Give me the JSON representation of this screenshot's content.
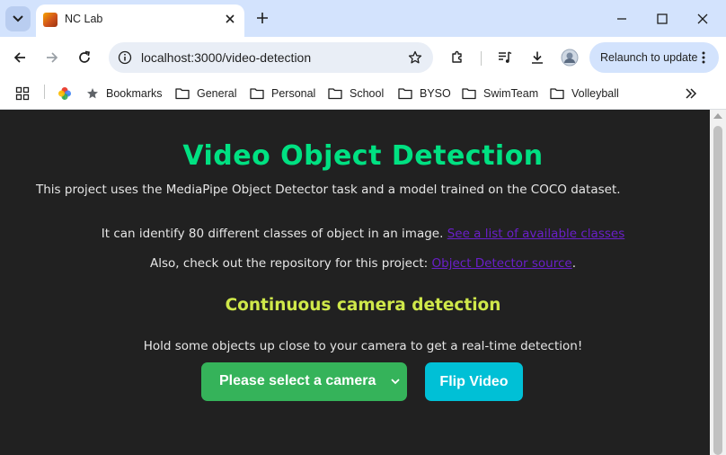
{
  "browser": {
    "tab": {
      "title": "NC Lab",
      "favicon": "nc-lab-favicon"
    },
    "address": {
      "url": "localhost:3000/video-detection"
    },
    "relaunch_label": "Relaunch to update",
    "bookmarks": [
      {
        "label": "Bookmarks",
        "icon": "star-icon"
      },
      {
        "label": "General",
        "icon": "folder-icon"
      },
      {
        "label": "Personal",
        "icon": "folder-icon"
      },
      {
        "label": "School",
        "icon": "folder-icon"
      },
      {
        "label": "BYSO",
        "icon": "folder-icon"
      },
      {
        "label": "SwimTeam",
        "icon": "folder-icon"
      },
      {
        "label": "Volleyball",
        "icon": "folder-icon"
      }
    ]
  },
  "page": {
    "title": "Video Object Detection",
    "intro": "This project uses the MediaPipe Object Detector task and a model trained on the COCO dataset.",
    "classes_text": "It can identify 80 different classes of object in an image. ",
    "classes_link": "See a list of available classes",
    "repo_text": "Also, check out the repository for this project: ",
    "repo_link": "Object Detector source",
    "repo_suffix": ".",
    "section_title": "Continuous camera detection",
    "instruction": "Hold some objects up close to your camera to get a real-time detection!",
    "camera_select": "Please select a camera",
    "flip_button": "Flip Video"
  },
  "colors": {
    "title": "#00e182",
    "section_title": "#cfe84a",
    "link": "#6a1fc9",
    "select_bg": "#35b35a",
    "flip_bg": "#00c0d6",
    "page_bg": "#212121"
  }
}
